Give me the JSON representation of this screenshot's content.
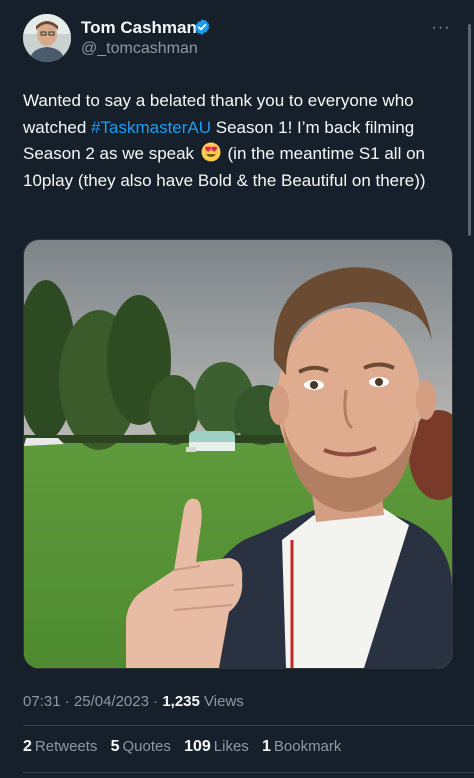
{
  "author": {
    "display_name": "Tom Cashman",
    "handle": "@_tomcashman",
    "verified": true,
    "more_label": "···"
  },
  "tweet": {
    "text_1": "Wanted to say a belated thank you to everyone who watched ",
    "hashtag": "#TaskmasterAU",
    "text_2": " Season 1! I’m back filming Season 2 as we speak ",
    "emoji_name": "heart-eyes-emoji",
    "text_3": " (in the meantime S1 all on 10play (they also have Bold & the Beautiful on there))"
  },
  "meta": {
    "time": "07:31",
    "date": "25/04/2023",
    "views_count": "1,235",
    "views_label": "Views",
    "separator": "·"
  },
  "stats": {
    "retweets_count": "2",
    "retweets_label": "Retweets",
    "quotes_count": "5",
    "quotes_label": "Quotes",
    "likes_count": "109",
    "likes_label": "Likes",
    "bookmarks_count": "1",
    "bookmarks_label": "Bookmark"
  },
  "colors": {
    "background": "#15202b",
    "link": "#1d9bf0",
    "muted_text": "#8b98a5",
    "verified_badge": "#1d9bf0"
  }
}
